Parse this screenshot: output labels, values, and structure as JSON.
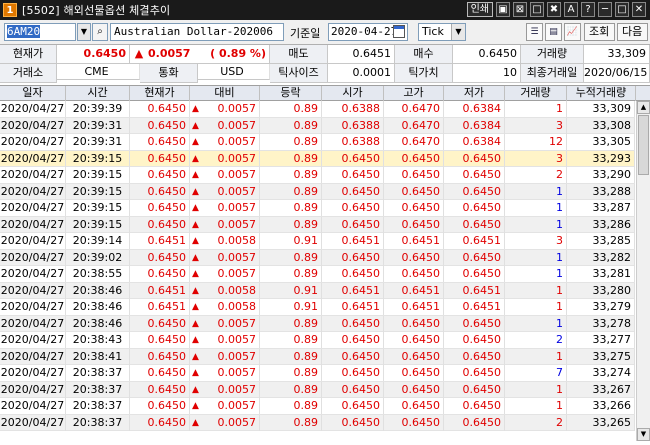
{
  "window": {
    "title": "[5502] 해외선물옵션 체결추이",
    "number_badge": "1",
    "controls": [
      "인쇄",
      "▣",
      "⊠",
      "□",
      "✖",
      "A",
      "?",
      "─",
      "□",
      "✕"
    ]
  },
  "toolbar": {
    "code_value": "6AM20",
    "product_name": "Australian Dollar-202006",
    "date_label": "기준일",
    "date_value": "2020-04-27",
    "tick_value": "Tick",
    "query_label": "조회",
    "next_label": "다음"
  },
  "info": {
    "row1": {
      "current_label": "현재가",
      "current_value": "0.6450",
      "change_arrow": "▲",
      "change_value": "0.0057",
      "change_pct": "( 0.89 %)",
      "ask_label": "매도",
      "ask_value": "0.6451",
      "bid_label": "매수",
      "bid_value": "0.6450",
      "volume_label": "거래량",
      "volume_value": "33,309"
    },
    "row2": {
      "exchange_label": "거래소",
      "exchange_value": "CME",
      "currency_label": "통화",
      "currency_value": "USD",
      "ticksize_label": "틱사이즈",
      "ticksize_value": "0.0001",
      "tickvalue_label": "틱가치",
      "tickvalue_value": "10",
      "lastday_label": "최종거래일",
      "lastday_value": "2020/06/15"
    }
  },
  "grid": {
    "columns": [
      "일자",
      "시간",
      "현재가",
      "대비",
      "등락",
      "시가",
      "고가",
      "저가",
      "거래량",
      "누적거래량"
    ],
    "rows": [
      {
        "date": "2020/04/27",
        "time": "20:39:39",
        "price": "0.6450",
        "diff": "0.0057",
        "rate": "0.89",
        "open": "0.6388",
        "high": "0.6470",
        "low": "0.6384",
        "vol": "1",
        "vol_color": "red",
        "cum": "33,309"
      },
      {
        "date": "2020/04/27",
        "time": "20:39:31",
        "price": "0.6450",
        "diff": "0.0057",
        "rate": "0.89",
        "open": "0.6388",
        "high": "0.6470",
        "low": "0.6384",
        "vol": "3",
        "vol_color": "red",
        "cum": "33,308"
      },
      {
        "date": "2020/04/27",
        "time": "20:39:31",
        "price": "0.6450",
        "diff": "0.0057",
        "rate": "0.89",
        "open": "0.6388",
        "high": "0.6470",
        "low": "0.6384",
        "vol": "12",
        "vol_color": "red",
        "cum": "33,305"
      },
      {
        "date": "2020/04/27",
        "time": "20:39:15",
        "price": "0.6450",
        "diff": "0.0057",
        "rate": "0.89",
        "open": "0.6450",
        "high": "0.6450",
        "low": "0.6450",
        "vol": "3",
        "vol_color": "red",
        "cum": "33,293"
      },
      {
        "date": "2020/04/27",
        "time": "20:39:15",
        "price": "0.6450",
        "diff": "0.0057",
        "rate": "0.89",
        "open": "0.6450",
        "high": "0.6450",
        "low": "0.6450",
        "vol": "2",
        "vol_color": "red",
        "cum": "33,290"
      },
      {
        "date": "2020/04/27",
        "time": "20:39:15",
        "price": "0.6450",
        "diff": "0.0057",
        "rate": "0.89",
        "open": "0.6450",
        "high": "0.6450",
        "low": "0.6450",
        "vol": "1",
        "vol_color": "blue",
        "cum": "33,288"
      },
      {
        "date": "2020/04/27",
        "time": "20:39:15",
        "price": "0.6450",
        "diff": "0.0057",
        "rate": "0.89",
        "open": "0.6450",
        "high": "0.6450",
        "low": "0.6450",
        "vol": "1",
        "vol_color": "blue",
        "cum": "33,287"
      },
      {
        "date": "2020/04/27",
        "time": "20:39:15",
        "price": "0.6450",
        "diff": "0.0057",
        "rate": "0.89",
        "open": "0.6450",
        "high": "0.6450",
        "low": "0.6450",
        "vol": "1",
        "vol_color": "blue",
        "cum": "33,286"
      },
      {
        "date": "2020/04/27",
        "time": "20:39:14",
        "price": "0.6451",
        "diff": "0.0058",
        "rate": "0.91",
        "open": "0.6451",
        "high": "0.6451",
        "low": "0.6451",
        "vol": "3",
        "vol_color": "red",
        "cum": "33,285"
      },
      {
        "date": "2020/04/27",
        "time": "20:39:02",
        "price": "0.6450",
        "diff": "0.0057",
        "rate": "0.89",
        "open": "0.6450",
        "high": "0.6450",
        "low": "0.6450",
        "vol": "1",
        "vol_color": "blue",
        "cum": "33,282"
      },
      {
        "date": "2020/04/27",
        "time": "20:38:55",
        "price": "0.6450",
        "diff": "0.0057",
        "rate": "0.89",
        "open": "0.6450",
        "high": "0.6450",
        "low": "0.6450",
        "vol": "1",
        "vol_color": "blue",
        "cum": "33,281"
      },
      {
        "date": "2020/04/27",
        "time": "20:38:46",
        "price": "0.6451",
        "diff": "0.0058",
        "rate": "0.91",
        "open": "0.6451",
        "high": "0.6451",
        "low": "0.6451",
        "vol": "1",
        "vol_color": "red",
        "cum": "33,280"
      },
      {
        "date": "2020/04/27",
        "time": "20:38:46",
        "price": "0.6451",
        "diff": "0.0058",
        "rate": "0.91",
        "open": "0.6451",
        "high": "0.6451",
        "low": "0.6451",
        "vol": "1",
        "vol_color": "red",
        "cum": "33,279"
      },
      {
        "date": "2020/04/27",
        "time": "20:38:46",
        "price": "0.6450",
        "diff": "0.0057",
        "rate": "0.89",
        "open": "0.6450",
        "high": "0.6450",
        "low": "0.6450",
        "vol": "1",
        "vol_color": "blue",
        "cum": "33,278"
      },
      {
        "date": "2020/04/27",
        "time": "20:38:43",
        "price": "0.6450",
        "diff": "0.0057",
        "rate": "0.89",
        "open": "0.6450",
        "high": "0.6450",
        "low": "0.6450",
        "vol": "2",
        "vol_color": "blue",
        "cum": "33,277"
      },
      {
        "date": "2020/04/27",
        "time": "20:38:41",
        "price": "0.6450",
        "diff": "0.0057",
        "rate": "0.89",
        "open": "0.6450",
        "high": "0.6450",
        "low": "0.6450",
        "vol": "1",
        "vol_color": "red",
        "cum": "33,275"
      },
      {
        "date": "2020/04/27",
        "time": "20:38:37",
        "price": "0.6450",
        "diff": "0.0057",
        "rate": "0.89",
        "open": "0.6450",
        "high": "0.6450",
        "low": "0.6450",
        "vol": "7",
        "vol_color": "blue",
        "cum": "33,274"
      },
      {
        "date": "2020/04/27",
        "time": "20:38:37",
        "price": "0.6450",
        "diff": "0.0057",
        "rate": "0.89",
        "open": "0.6450",
        "high": "0.6450",
        "low": "0.6450",
        "vol": "1",
        "vol_color": "red",
        "cum": "33,267"
      },
      {
        "date": "2020/04/27",
        "time": "20:38:37",
        "price": "0.6450",
        "diff": "0.0057",
        "rate": "0.89",
        "open": "0.6450",
        "high": "0.6450",
        "low": "0.6450",
        "vol": "1",
        "vol_color": "red",
        "cum": "33,266"
      },
      {
        "date": "2020/04/27",
        "time": "20:38:37",
        "price": "0.6450",
        "diff": "0.0057",
        "rate": "0.89",
        "open": "0.6450",
        "high": "0.6450",
        "low": "0.6450",
        "vol": "2",
        "vol_color": "red",
        "cum": "33,265"
      }
    ],
    "selected_row": 3,
    "up_arrow": "▲"
  },
  "colors": {
    "up": "#e00000",
    "down": "#0000e0",
    "selected_row": "#fff4c8",
    "header_bg": "#e4e8f0"
  }
}
